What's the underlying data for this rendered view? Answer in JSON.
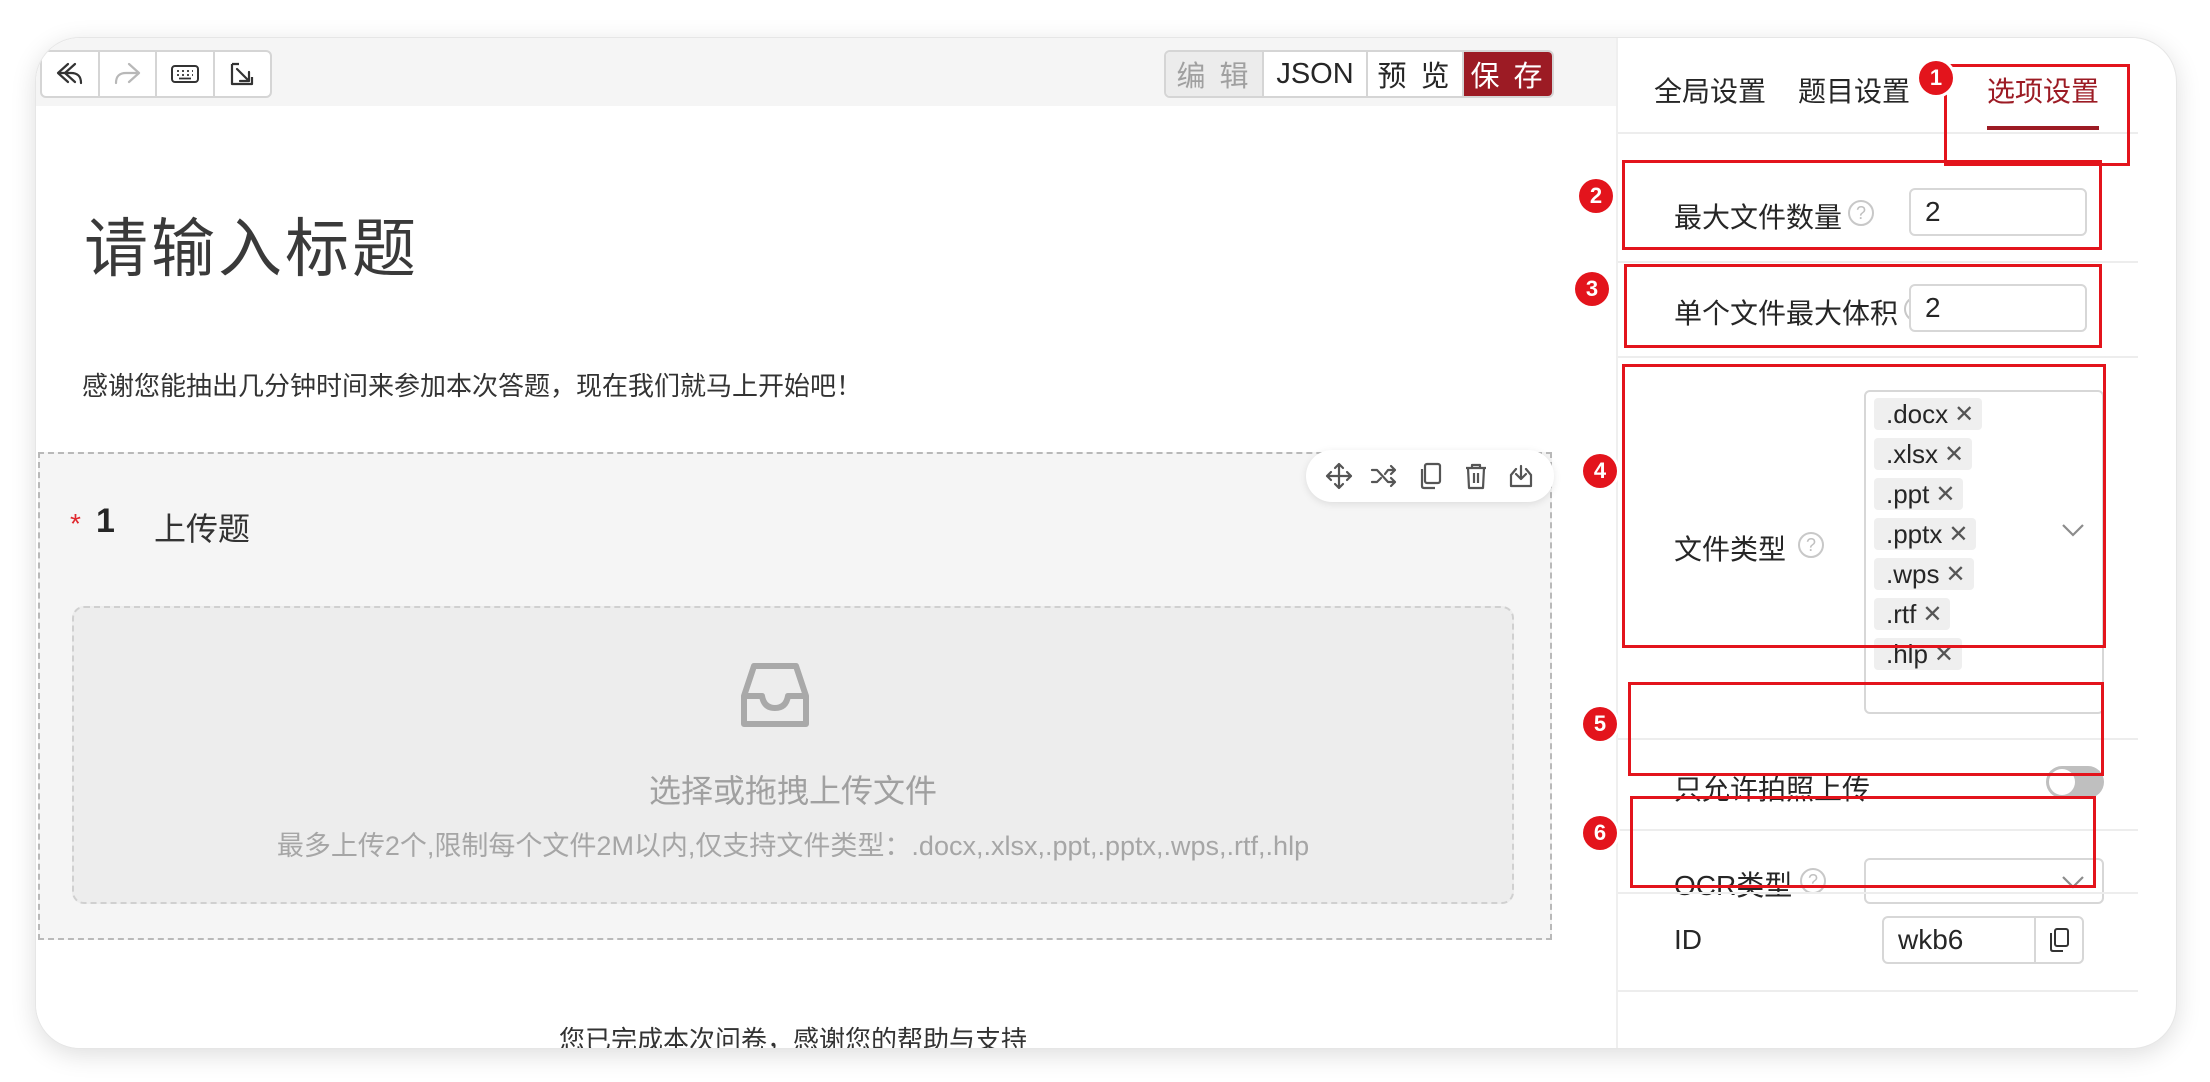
{
  "toolbar": {
    "undo_icon": "undo-icon",
    "redo_icon": "redo-icon",
    "keyboard_icon": "keyboard-icon",
    "import_icon": "import-icon",
    "modes": {
      "edit": "编 辑",
      "json": "JSON",
      "preview": "预 览",
      "save": "保 存"
    }
  },
  "survey": {
    "title": "请输入标题",
    "intro": "感谢您能抽出几分钟时间来参加本次答题，现在我们就马上开始吧！",
    "end_text": "您已完成本次问卷，感谢您的帮助与支持"
  },
  "question": {
    "required_mark": "*",
    "number": "1",
    "title": "上传题",
    "tools": [
      "move-icon",
      "shuffle-icon",
      "copy-icon",
      "delete-icon",
      "save-to-bank-icon"
    ],
    "upload": {
      "icon": "inbox-icon",
      "main_text": "选择或拖拽上传文件",
      "hint": "最多上传2个,限制每个文件2M以内,仅支持文件类型：.docx,.xlsx,.ppt,.pptx,.wps,.rtf,.hlp"
    }
  },
  "panel": {
    "tabs": {
      "global": "全局设置",
      "question": "题目设置",
      "options": "选项设置"
    },
    "active_tab": "选项设置",
    "max_files": {
      "label": "最大文件数量",
      "value": "2"
    },
    "max_size": {
      "label": "单个文件最大体积",
      "value": "2"
    },
    "file_types": {
      "label": "文件类型",
      "tags": [
        ".docx",
        ".xlsx",
        ".ppt",
        ".pptx",
        ".wps",
        ".rtf",
        ".hlp"
      ]
    },
    "photo_only": {
      "label": "只允许拍照上传",
      "enabled": false
    },
    "ocr_type": {
      "label": "OCR类型",
      "value": ""
    },
    "id": {
      "label": "ID",
      "value": "wkb6"
    }
  },
  "annotations": [
    "1",
    "2",
    "3",
    "4",
    "5",
    "6"
  ],
  "colors": {
    "brand": "#9c1b24",
    "annotation": "#e3141c",
    "required": "#e0282e"
  }
}
